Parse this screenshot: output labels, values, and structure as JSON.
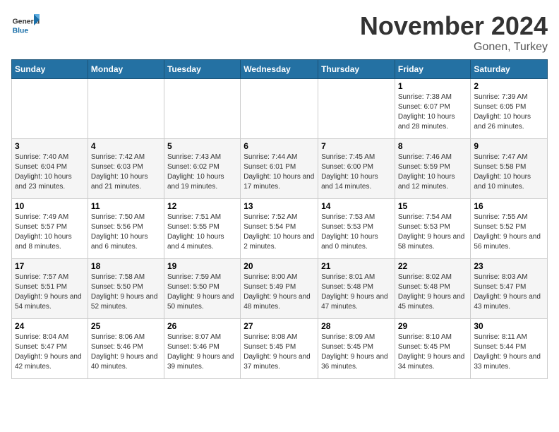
{
  "logo": {
    "text_general": "General",
    "text_blue": "Blue"
  },
  "header": {
    "month_title": "November 2024",
    "location": "Gonen, Turkey"
  },
  "weekdays": [
    "Sunday",
    "Monday",
    "Tuesday",
    "Wednesday",
    "Thursday",
    "Friday",
    "Saturday"
  ],
  "weeks": [
    [
      {
        "day": "",
        "info": ""
      },
      {
        "day": "",
        "info": ""
      },
      {
        "day": "",
        "info": ""
      },
      {
        "day": "",
        "info": ""
      },
      {
        "day": "",
        "info": ""
      },
      {
        "day": "1",
        "info": "Sunrise: 7:38 AM\nSunset: 6:07 PM\nDaylight: 10 hours and 28 minutes."
      },
      {
        "day": "2",
        "info": "Sunrise: 7:39 AM\nSunset: 6:05 PM\nDaylight: 10 hours and 26 minutes."
      }
    ],
    [
      {
        "day": "3",
        "info": "Sunrise: 7:40 AM\nSunset: 6:04 PM\nDaylight: 10 hours and 23 minutes."
      },
      {
        "day": "4",
        "info": "Sunrise: 7:42 AM\nSunset: 6:03 PM\nDaylight: 10 hours and 21 minutes."
      },
      {
        "day": "5",
        "info": "Sunrise: 7:43 AM\nSunset: 6:02 PM\nDaylight: 10 hours and 19 minutes."
      },
      {
        "day": "6",
        "info": "Sunrise: 7:44 AM\nSunset: 6:01 PM\nDaylight: 10 hours and 17 minutes."
      },
      {
        "day": "7",
        "info": "Sunrise: 7:45 AM\nSunset: 6:00 PM\nDaylight: 10 hours and 14 minutes."
      },
      {
        "day": "8",
        "info": "Sunrise: 7:46 AM\nSunset: 5:59 PM\nDaylight: 10 hours and 12 minutes."
      },
      {
        "day": "9",
        "info": "Sunrise: 7:47 AM\nSunset: 5:58 PM\nDaylight: 10 hours and 10 minutes."
      }
    ],
    [
      {
        "day": "10",
        "info": "Sunrise: 7:49 AM\nSunset: 5:57 PM\nDaylight: 10 hours and 8 minutes."
      },
      {
        "day": "11",
        "info": "Sunrise: 7:50 AM\nSunset: 5:56 PM\nDaylight: 10 hours and 6 minutes."
      },
      {
        "day": "12",
        "info": "Sunrise: 7:51 AM\nSunset: 5:55 PM\nDaylight: 10 hours and 4 minutes."
      },
      {
        "day": "13",
        "info": "Sunrise: 7:52 AM\nSunset: 5:54 PM\nDaylight: 10 hours and 2 minutes."
      },
      {
        "day": "14",
        "info": "Sunrise: 7:53 AM\nSunset: 5:53 PM\nDaylight: 10 hours and 0 minutes."
      },
      {
        "day": "15",
        "info": "Sunrise: 7:54 AM\nSunset: 5:53 PM\nDaylight: 9 hours and 58 minutes."
      },
      {
        "day": "16",
        "info": "Sunrise: 7:55 AM\nSunset: 5:52 PM\nDaylight: 9 hours and 56 minutes."
      }
    ],
    [
      {
        "day": "17",
        "info": "Sunrise: 7:57 AM\nSunset: 5:51 PM\nDaylight: 9 hours and 54 minutes."
      },
      {
        "day": "18",
        "info": "Sunrise: 7:58 AM\nSunset: 5:50 PM\nDaylight: 9 hours and 52 minutes."
      },
      {
        "day": "19",
        "info": "Sunrise: 7:59 AM\nSunset: 5:50 PM\nDaylight: 9 hours and 50 minutes."
      },
      {
        "day": "20",
        "info": "Sunrise: 8:00 AM\nSunset: 5:49 PM\nDaylight: 9 hours and 48 minutes."
      },
      {
        "day": "21",
        "info": "Sunrise: 8:01 AM\nSunset: 5:48 PM\nDaylight: 9 hours and 47 minutes."
      },
      {
        "day": "22",
        "info": "Sunrise: 8:02 AM\nSunset: 5:48 PM\nDaylight: 9 hours and 45 minutes."
      },
      {
        "day": "23",
        "info": "Sunrise: 8:03 AM\nSunset: 5:47 PM\nDaylight: 9 hours and 43 minutes."
      }
    ],
    [
      {
        "day": "24",
        "info": "Sunrise: 8:04 AM\nSunset: 5:47 PM\nDaylight: 9 hours and 42 minutes."
      },
      {
        "day": "25",
        "info": "Sunrise: 8:06 AM\nSunset: 5:46 PM\nDaylight: 9 hours and 40 minutes."
      },
      {
        "day": "26",
        "info": "Sunrise: 8:07 AM\nSunset: 5:46 PM\nDaylight: 9 hours and 39 minutes."
      },
      {
        "day": "27",
        "info": "Sunrise: 8:08 AM\nSunset: 5:45 PM\nDaylight: 9 hours and 37 minutes."
      },
      {
        "day": "28",
        "info": "Sunrise: 8:09 AM\nSunset: 5:45 PM\nDaylight: 9 hours and 36 minutes."
      },
      {
        "day": "29",
        "info": "Sunrise: 8:10 AM\nSunset: 5:45 PM\nDaylight: 9 hours and 34 minutes."
      },
      {
        "day": "30",
        "info": "Sunrise: 8:11 AM\nSunset: 5:44 PM\nDaylight: 9 hours and 33 minutes."
      }
    ]
  ]
}
